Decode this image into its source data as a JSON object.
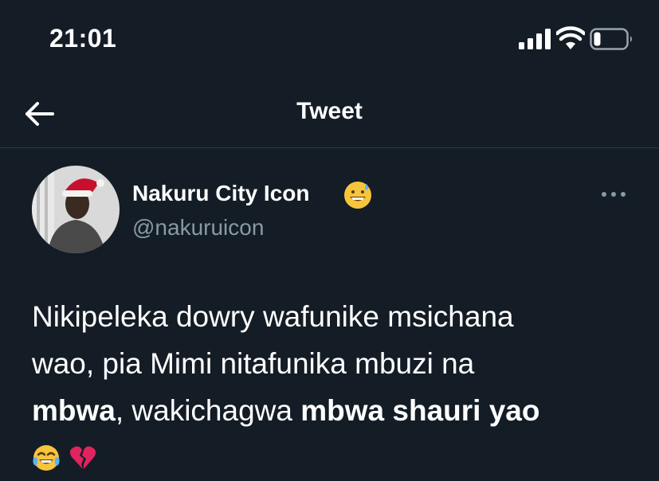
{
  "status_bar": {
    "time": "21:01",
    "signal_icon": "cellular-signal-icon",
    "wifi_icon": "wifi-icon",
    "battery_icon": "battery-low-icon",
    "battery_level": 0.15
  },
  "header": {
    "back_icon": "arrow-left-icon",
    "title": "Tweet"
  },
  "tweet": {
    "author": {
      "display_name": "Nakuru City Icon",
      "name_emoji": "grinning-face-with-sweat-icon",
      "handle": "@nakuruicon"
    },
    "more_icon": "more-horizontal-icon",
    "text": {
      "line1": "Nikipeleka dowry wafunike msichana",
      "line2": "wao, pia Mimi nitafunika mbuzi na",
      "bold1": "mbwa",
      "mid": ", wakichagwa ",
      "bold2": "mbwa shauri yao",
      "emojis": [
        "face-with-tears-of-joy-icon",
        "broken-heart-icon"
      ]
    }
  },
  "colors": {
    "background": "#141d26",
    "text_primary": "#ffffff",
    "text_secondary": "#8899a6",
    "divider": "#2a3642"
  }
}
